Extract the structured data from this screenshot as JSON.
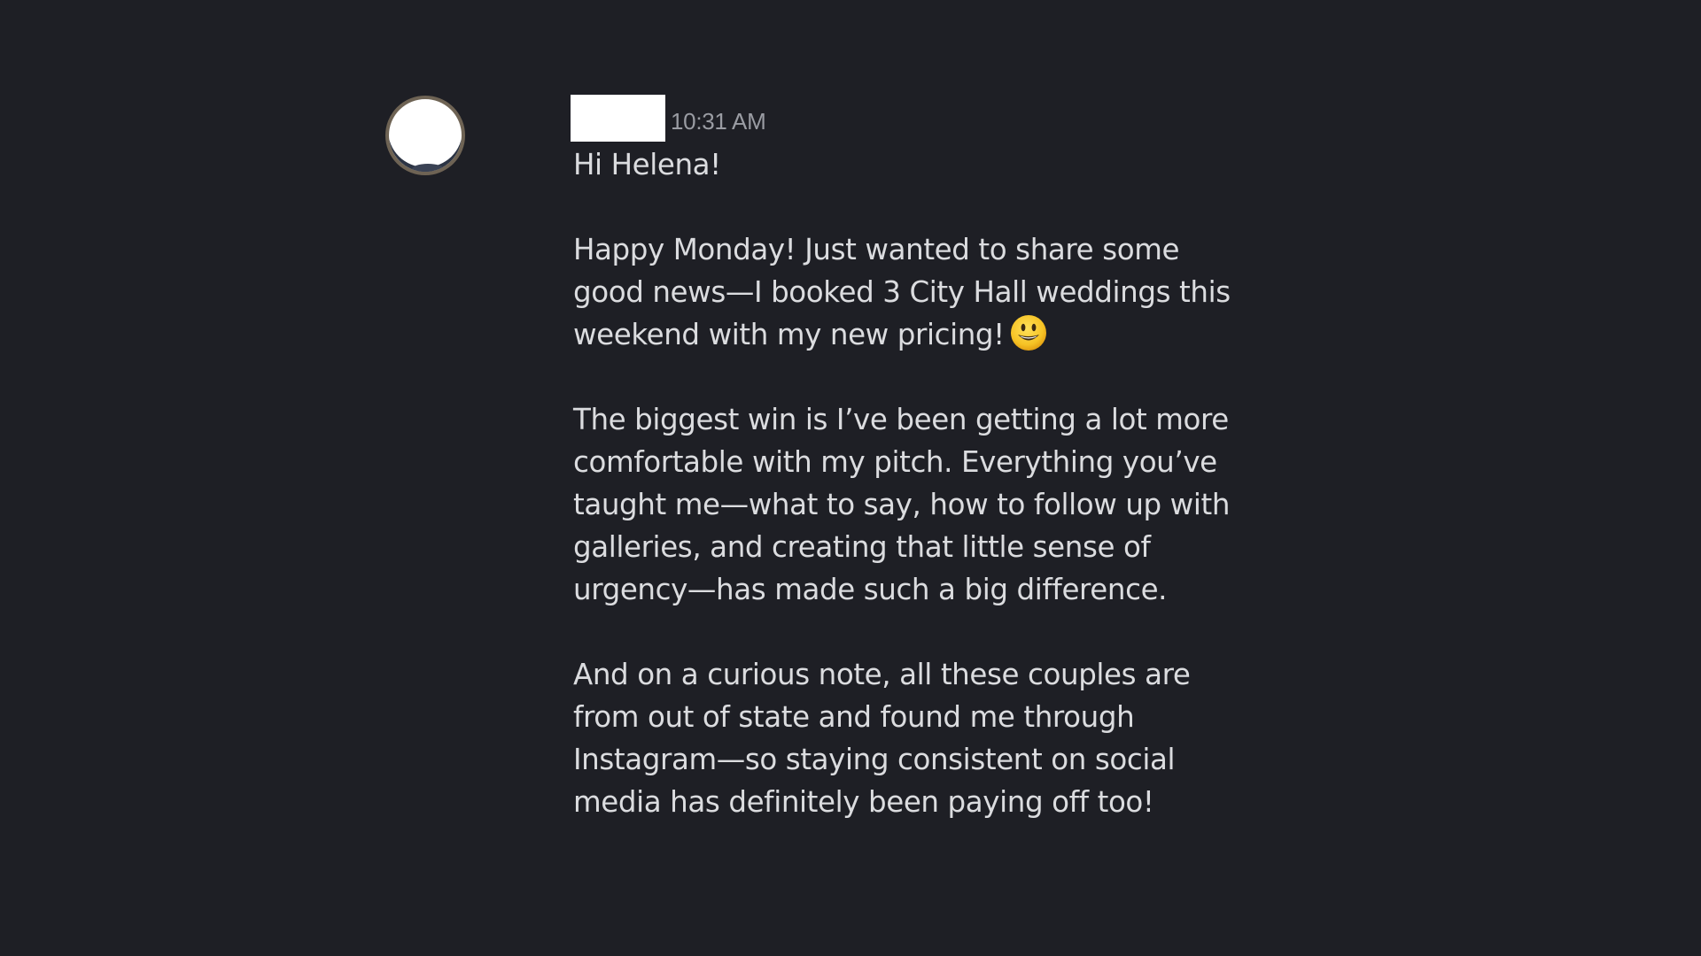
{
  "message": {
    "timestamp": "10:31 AM",
    "paragraphs": [
      "Hi Helena!",
      "Happy Monday! Just wanted to share some good news—I booked 3 City Hall weddings this weekend with my new pricing!",
      "The biggest win is I’ve been getting a lot more comfortable with my pitch. Everything you’ve taught me—what to say, how to follow up with galleries, and creating that little sense of urgency—has made such a big difference.",
      "And on a curious note, all these couples are from out of state and found me through Instagram—so staying consistent on social media has definitely been paying off too!"
    ],
    "emoji": "smiling-face-emoji"
  },
  "colors": {
    "background": "#1e1f25",
    "text": "#dbdcdf",
    "timestamp": "#9a9ca3",
    "redaction": "#ffffff"
  }
}
